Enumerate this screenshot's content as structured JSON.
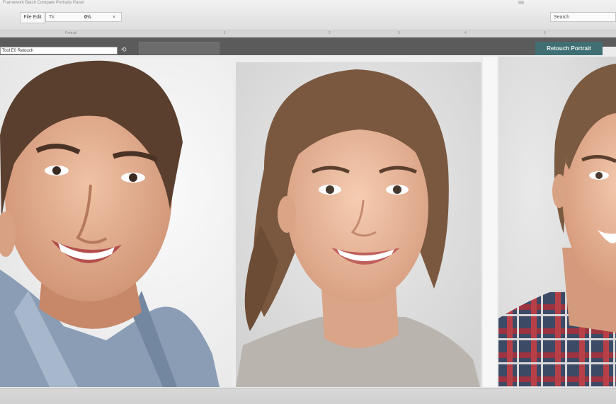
{
  "topbar": {
    "breadcrumb": "Framework Batch Compare Portraits Panel",
    "tab_label": "File Edit",
    "address_text": "Tk",
    "address_number": "0½",
    "address_close": "×",
    "search_text": "Search",
    "top_right_text": "▪"
  },
  "ruler": {
    "marks": [
      "Portrait",
      "1",
      "2",
      "3",
      "4",
      "5"
    ]
  },
  "toolbar": {
    "input_value": "Tool E0 Retouch",
    "icon_glyph": "⟲",
    "action_label": "Retouch Portrait"
  },
  "portraits": [
    {
      "subject": "young man smiling, denim shirt"
    },
    {
      "subject": "young woman smiling, grey sweater"
    },
    {
      "subject": "young person smiling, plaid shirt"
    }
  ],
  "colors": {
    "toolbar": "#5b5b5b",
    "accent_button": "#3f6f73",
    "canvas": "#ededed"
  }
}
